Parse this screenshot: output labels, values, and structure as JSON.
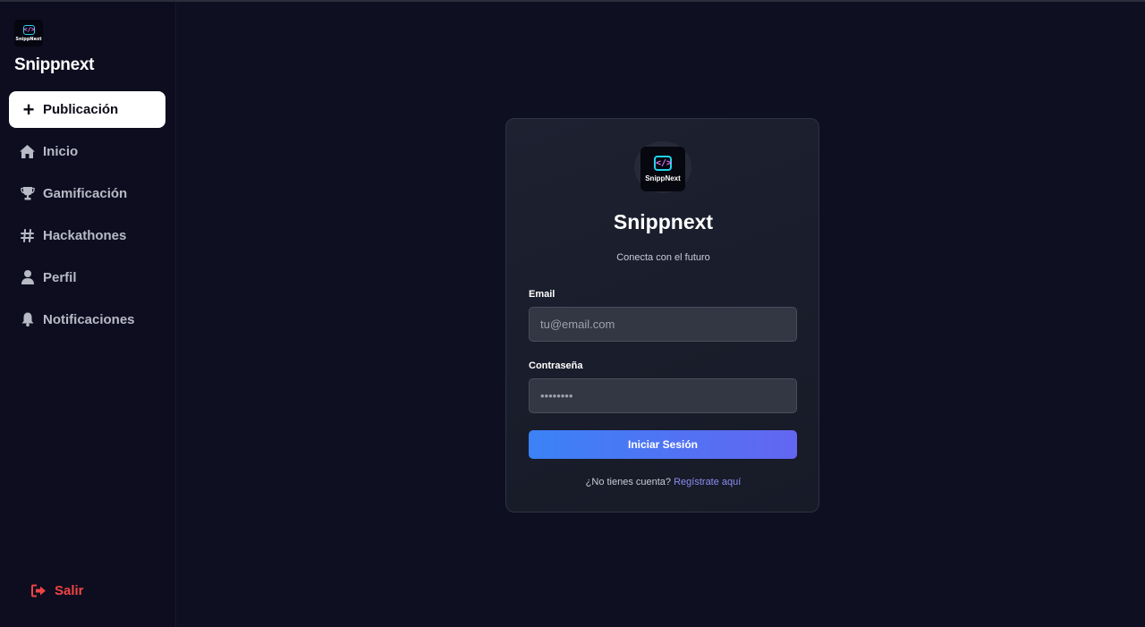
{
  "sidebar": {
    "brand": {
      "name": "Snippnext",
      "logo_text": "SnippNext",
      "logo_mark": "</>"
    },
    "primary_action": {
      "label": "Publicación",
      "icon": "plus-icon"
    },
    "items": [
      {
        "label": "Inicio",
        "icon": "home-icon"
      },
      {
        "label": "Gamificación",
        "icon": "trophy-icon"
      },
      {
        "label": "Hackathones",
        "icon": "hashtag-icon"
      },
      {
        "label": "Perfil",
        "icon": "user-icon"
      },
      {
        "label": "Notificaciones",
        "icon": "bell-icon"
      }
    ],
    "logout": {
      "label": "Salir",
      "icon": "sign-out-icon"
    }
  },
  "login": {
    "logo_text": "SnippNext",
    "logo_mark": "</>",
    "title": "Snippnext",
    "subtitle": "Conecta con el futuro",
    "email": {
      "label": "Email",
      "placeholder": "tu@email.com"
    },
    "password": {
      "label": "Contraseña",
      "placeholder": "••••••••"
    },
    "submit_label": "Iniciar Sesión",
    "signup_prompt": "¿No tienes cuenta?",
    "signup_link": "Regístrate aquí"
  },
  "colors": {
    "background": "#0f0f22",
    "sidebar": "#0d0d1f",
    "accent_start": "#3b82f6",
    "accent_end": "#6366f1",
    "danger": "#ef4444",
    "link": "#8b8ef0"
  }
}
